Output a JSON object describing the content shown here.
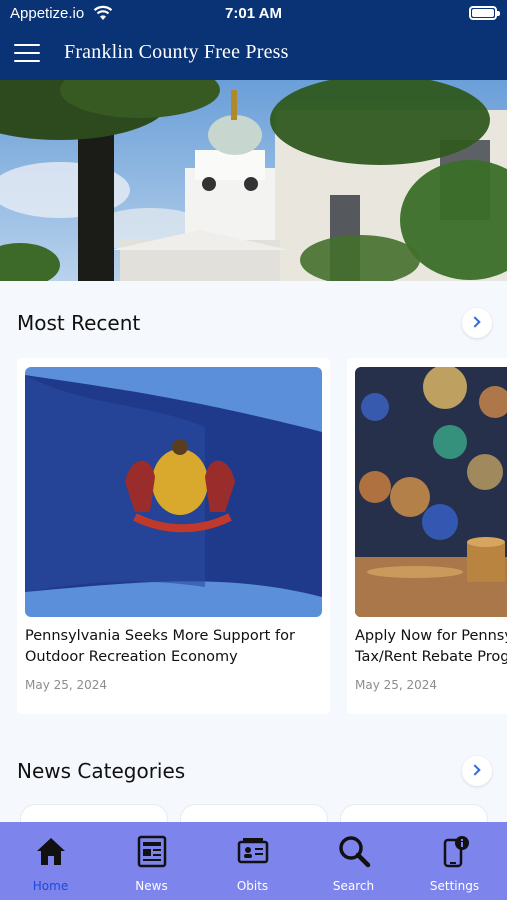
{
  "status_bar": {
    "carrier": "Appetize.io",
    "time": "7:01 AM"
  },
  "header": {
    "title": "Franklin County Free Press",
    "menu_icon": "hamburger-icon"
  },
  "most_recent": {
    "title": "Most Recent",
    "articles": [
      {
        "headline": "Pennsylvania Seeks More Support for\nOutdoor Recreation Economy",
        "date": "May 25, 2024"
      },
      {
        "headline": "Apply Now for Pennsylvania\nTax/Rent Rebate Program",
        "date": "May 25, 2024"
      }
    ]
  },
  "news_categories": {
    "title": "News Categories"
  },
  "tab_bar": {
    "tabs": [
      {
        "label": "Home",
        "icon": "home-icon",
        "active": true
      },
      {
        "label": "News",
        "icon": "newspaper-icon",
        "active": false
      },
      {
        "label": "Obits",
        "icon": "obituary-icon",
        "active": false
      },
      {
        "label": "Search",
        "icon": "search-icon",
        "active": false
      },
      {
        "label": "Settings",
        "icon": "settings-icon",
        "active": false
      }
    ]
  },
  "colors": {
    "header_bg": "#093374",
    "tab_bar_bg": "#7d84ec",
    "active_tab": "#1d49d8",
    "accent": "#2f6bd9"
  }
}
